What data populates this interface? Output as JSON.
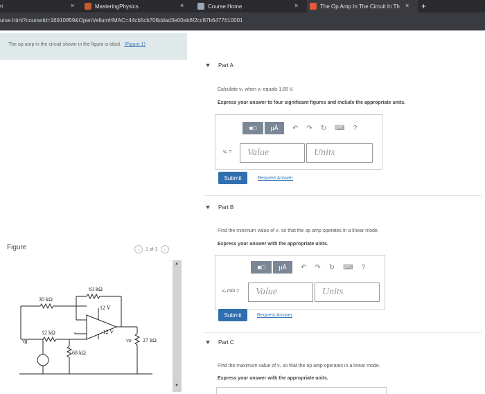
{
  "browser": {
    "tabs": [
      {
        "label": "MasteringPhysics"
      },
      {
        "label": "Course Home"
      },
      {
        "label": "The Op Amp In The Circuit In Th"
      }
    ],
    "new_tab": "+",
    "close": "×",
    "url": "urse.html?courseId=16910859&OpenVellumHMAC=44cb5cb708ddad3e00eb6f2cc87b6477#10001"
  },
  "problem": {
    "statement": "The op amp in the circuit shown in the figure is ideal.",
    "figure_link": "(Figure 1)"
  },
  "figure": {
    "label": "Figure",
    "pager": "1 of 1",
    "prev": "‹",
    "next": "›",
    "circuit": {
      "r1": "30 kΩ",
      "r2": "63 kΩ",
      "r3": "12 kΩ",
      "r4": "68 kΩ",
      "r5": "27 kΩ",
      "vpos": "12 V",
      "vneg": "−12 V",
      "vg": "vg",
      "vo": "vo"
    }
  },
  "parts": {
    "a": {
      "title": "Part A",
      "question": "Calculate vₒ when v₇ equals 1.85 V.",
      "instruction": "Express your answer to four significant figures and include the appropriate units.",
      "var_label": "vₒ =",
      "value_placeholder": "Value",
      "units_placeholder": "Units",
      "submit": "Submit",
      "request": "Request Answer"
    },
    "b": {
      "title": "Part B",
      "question": "Find the minimum value of v₇ so that the op amp operates in a linear mode.",
      "instruction": "Express your answer with the appropriate units.",
      "var_label": "v₇ min =",
      "value_placeholder": "Value",
      "units_placeholder": "Units",
      "submit": "Submit",
      "request": "Request Answer"
    },
    "c": {
      "title": "Part C",
      "question": "Find the maximum value of v₇ so that the op amp operates in a linear mode.",
      "instruction": "Express your answer with the appropriate units."
    }
  },
  "toolbar": {
    "matrix": "■□",
    "mu": "μÅ",
    "undo": "↶",
    "redo": "↷",
    "reset": "↻",
    "keyboard": "⌨",
    "help": "?"
  },
  "colors": {
    "accent": "#2f6fae",
    "statement_bg": "#dfe9ea",
    "link": "#3b79b5"
  }
}
